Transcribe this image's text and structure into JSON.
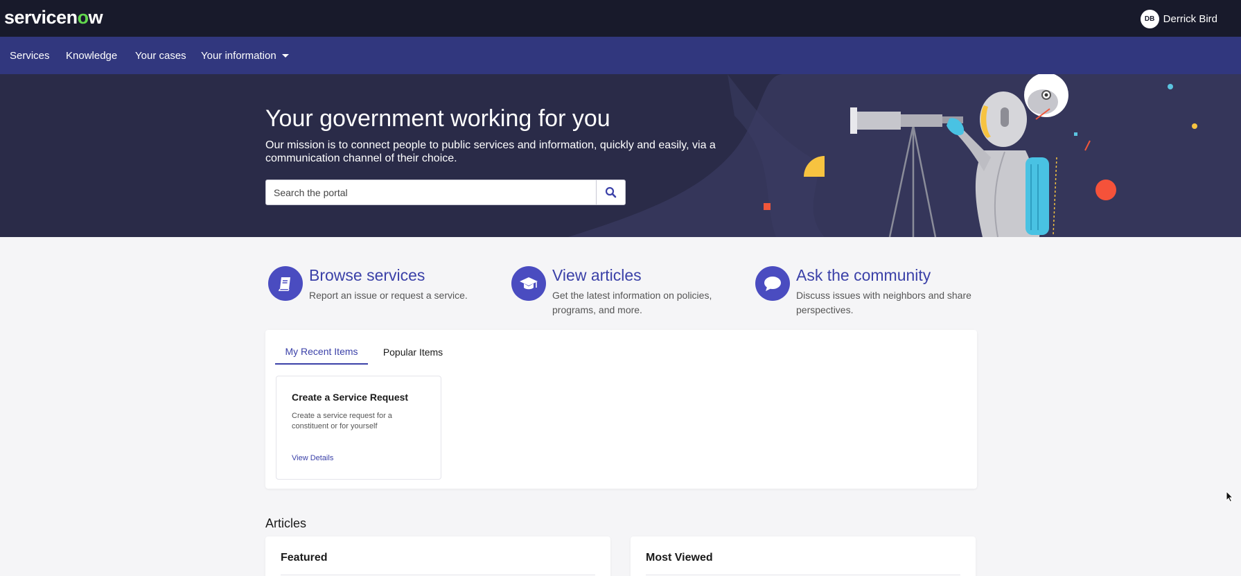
{
  "header": {
    "logo_text": "servicenow",
    "user": {
      "initials": "DB",
      "name": "Derrick Bird"
    }
  },
  "nav": {
    "items": [
      {
        "label": "Services"
      },
      {
        "label": "Knowledge"
      },
      {
        "label": "Your cases"
      },
      {
        "label": "Your information",
        "has_dropdown": true
      }
    ]
  },
  "hero": {
    "title": "Your government working for you",
    "subtitle": "Our mission is to connect people to public services and information, quickly and easily, via a communication channel of their choice.",
    "search": {
      "placeholder": "Search the portal",
      "value": ""
    }
  },
  "quick_links": [
    {
      "icon": "book-icon",
      "title": "Browse services",
      "description": "Report an issue or request a service."
    },
    {
      "icon": "graduation-cap-icon",
      "title": "View articles",
      "description": "Get the latest information on policies, programs, and more."
    },
    {
      "icon": "chat-bubble-icon",
      "title": "Ask the community",
      "description": "Discuss issues with neighbors and share perspectives."
    }
  ],
  "recent_panel": {
    "tabs": [
      {
        "label": "My Recent Items",
        "active": true
      },
      {
        "label": "Popular Items",
        "active": false
      }
    ],
    "items": [
      {
        "title": "Create a Service Request",
        "description": "Create a service request for a constituent or for yourself",
        "link": "View Details"
      }
    ]
  },
  "articles": {
    "heading": "Articles",
    "cards": [
      {
        "title": "Featured"
      },
      {
        "title": "Most Viewed"
      }
    ]
  },
  "colors": {
    "topbar": "#181a2b",
    "navbar": "#31377e",
    "hero": "#2a2b48",
    "accent": "#3b41a8",
    "icon_bg": "#4a4cc0",
    "logo_accent": "#62d84e"
  }
}
